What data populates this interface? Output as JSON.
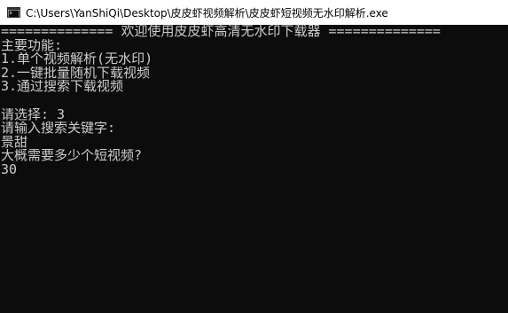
{
  "window": {
    "title": "C:\\Users\\YanShiQi\\Desktop\\皮皮虾视频解析\\皮皮虾短视频无水印解析.exe",
    "icon": "console-window-icon"
  },
  "console": {
    "lines": [
      "============== 欢迎使用皮皮虾高清无水印下载器 ==============",
      "主要功能:",
      "1.单个视频解析(无水印)",
      "2.一键批量随机下载视频",
      "3.通过搜索下载视频",
      "",
      "请选择: 3",
      "请输入搜索关键字:",
      "景甜",
      "大概需要多少个短视频?",
      "30"
    ]
  },
  "colors": {
    "background": "#0c0c0c",
    "text": "#cccccc",
    "titlebar": "#ffffff"
  }
}
